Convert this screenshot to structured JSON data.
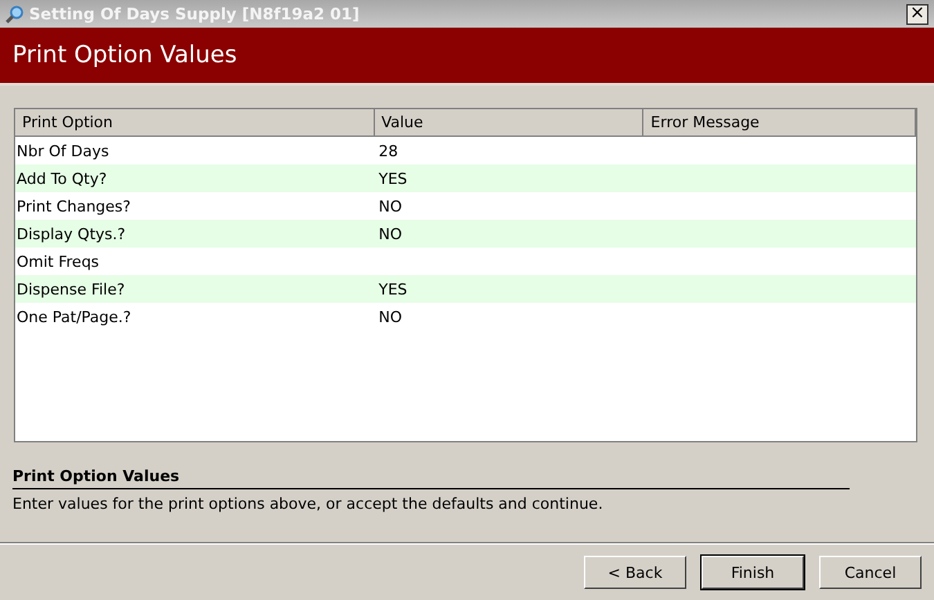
{
  "window": {
    "title": "Setting Of Days Supply [N8f19a2 01]",
    "close": "×"
  },
  "header": {
    "title": "Print Option Values"
  },
  "table": {
    "columns": [
      "Print Option",
      "Value",
      "Error Message"
    ],
    "rows": [
      {
        "option": "Nbr Of Days",
        "value": "28"
      },
      {
        "option": "Add To Qty?",
        "value": "YES"
      },
      {
        "option": "Print Changes?",
        "value": "NO"
      },
      {
        "option": "Display Qtys.?",
        "value": "NO"
      },
      {
        "option": "Omit Freqs",
        "value": ""
      },
      {
        "option": "Dispense File?",
        "value": "YES"
      },
      {
        "option": "One Pat/Page.?",
        "value": "NO"
      }
    ]
  },
  "help": {
    "title": "Print Option Values",
    "text": "Enter values for the print options above, or accept the defaults and continue."
  },
  "buttons": [
    {
      "label": "< Back",
      "default": false
    },
    {
      "label": "Finish",
      "default": true
    },
    {
      "label": "Cancel",
      "default": false
    }
  ]
}
